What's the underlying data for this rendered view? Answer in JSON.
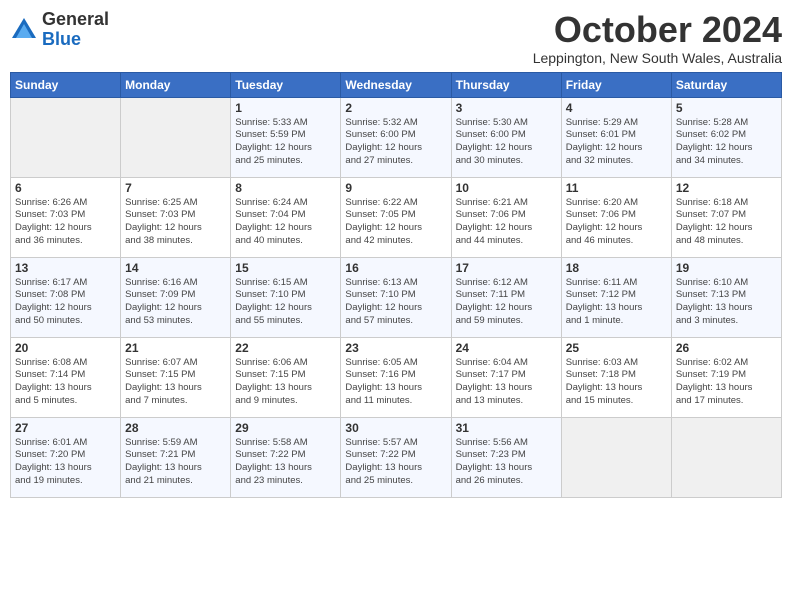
{
  "header": {
    "logo_line1": "General",
    "logo_line2": "Blue",
    "month": "October 2024",
    "location": "Leppington, New South Wales, Australia"
  },
  "weekdays": [
    "Sunday",
    "Monday",
    "Tuesday",
    "Wednesday",
    "Thursday",
    "Friday",
    "Saturday"
  ],
  "weeks": [
    [
      {
        "day": "",
        "info": ""
      },
      {
        "day": "",
        "info": ""
      },
      {
        "day": "1",
        "info": "Sunrise: 5:33 AM\nSunset: 5:59 PM\nDaylight: 12 hours\nand 25 minutes."
      },
      {
        "day": "2",
        "info": "Sunrise: 5:32 AM\nSunset: 6:00 PM\nDaylight: 12 hours\nand 27 minutes."
      },
      {
        "day": "3",
        "info": "Sunrise: 5:30 AM\nSunset: 6:00 PM\nDaylight: 12 hours\nand 30 minutes."
      },
      {
        "day": "4",
        "info": "Sunrise: 5:29 AM\nSunset: 6:01 PM\nDaylight: 12 hours\nand 32 minutes."
      },
      {
        "day": "5",
        "info": "Sunrise: 5:28 AM\nSunset: 6:02 PM\nDaylight: 12 hours\nand 34 minutes."
      }
    ],
    [
      {
        "day": "6",
        "info": "Sunrise: 6:26 AM\nSunset: 7:03 PM\nDaylight: 12 hours\nand 36 minutes."
      },
      {
        "day": "7",
        "info": "Sunrise: 6:25 AM\nSunset: 7:03 PM\nDaylight: 12 hours\nand 38 minutes."
      },
      {
        "day": "8",
        "info": "Sunrise: 6:24 AM\nSunset: 7:04 PM\nDaylight: 12 hours\nand 40 minutes."
      },
      {
        "day": "9",
        "info": "Sunrise: 6:22 AM\nSunset: 7:05 PM\nDaylight: 12 hours\nand 42 minutes."
      },
      {
        "day": "10",
        "info": "Sunrise: 6:21 AM\nSunset: 7:06 PM\nDaylight: 12 hours\nand 44 minutes."
      },
      {
        "day": "11",
        "info": "Sunrise: 6:20 AM\nSunset: 7:06 PM\nDaylight: 12 hours\nand 46 minutes."
      },
      {
        "day": "12",
        "info": "Sunrise: 6:18 AM\nSunset: 7:07 PM\nDaylight: 12 hours\nand 48 minutes."
      }
    ],
    [
      {
        "day": "13",
        "info": "Sunrise: 6:17 AM\nSunset: 7:08 PM\nDaylight: 12 hours\nand 50 minutes."
      },
      {
        "day": "14",
        "info": "Sunrise: 6:16 AM\nSunset: 7:09 PM\nDaylight: 12 hours\nand 53 minutes."
      },
      {
        "day": "15",
        "info": "Sunrise: 6:15 AM\nSunset: 7:10 PM\nDaylight: 12 hours\nand 55 minutes."
      },
      {
        "day": "16",
        "info": "Sunrise: 6:13 AM\nSunset: 7:10 PM\nDaylight: 12 hours\nand 57 minutes."
      },
      {
        "day": "17",
        "info": "Sunrise: 6:12 AM\nSunset: 7:11 PM\nDaylight: 12 hours\nand 59 minutes."
      },
      {
        "day": "18",
        "info": "Sunrise: 6:11 AM\nSunset: 7:12 PM\nDaylight: 13 hours\nand 1 minute."
      },
      {
        "day": "19",
        "info": "Sunrise: 6:10 AM\nSunset: 7:13 PM\nDaylight: 13 hours\nand 3 minutes."
      }
    ],
    [
      {
        "day": "20",
        "info": "Sunrise: 6:08 AM\nSunset: 7:14 PM\nDaylight: 13 hours\nand 5 minutes."
      },
      {
        "day": "21",
        "info": "Sunrise: 6:07 AM\nSunset: 7:15 PM\nDaylight: 13 hours\nand 7 minutes."
      },
      {
        "day": "22",
        "info": "Sunrise: 6:06 AM\nSunset: 7:15 PM\nDaylight: 13 hours\nand 9 minutes."
      },
      {
        "day": "23",
        "info": "Sunrise: 6:05 AM\nSunset: 7:16 PM\nDaylight: 13 hours\nand 11 minutes."
      },
      {
        "day": "24",
        "info": "Sunrise: 6:04 AM\nSunset: 7:17 PM\nDaylight: 13 hours\nand 13 minutes."
      },
      {
        "day": "25",
        "info": "Sunrise: 6:03 AM\nSunset: 7:18 PM\nDaylight: 13 hours\nand 15 minutes."
      },
      {
        "day": "26",
        "info": "Sunrise: 6:02 AM\nSunset: 7:19 PM\nDaylight: 13 hours\nand 17 minutes."
      }
    ],
    [
      {
        "day": "27",
        "info": "Sunrise: 6:01 AM\nSunset: 7:20 PM\nDaylight: 13 hours\nand 19 minutes."
      },
      {
        "day": "28",
        "info": "Sunrise: 5:59 AM\nSunset: 7:21 PM\nDaylight: 13 hours\nand 21 minutes."
      },
      {
        "day": "29",
        "info": "Sunrise: 5:58 AM\nSunset: 7:22 PM\nDaylight: 13 hours\nand 23 minutes."
      },
      {
        "day": "30",
        "info": "Sunrise: 5:57 AM\nSunset: 7:22 PM\nDaylight: 13 hours\nand 25 minutes."
      },
      {
        "day": "31",
        "info": "Sunrise: 5:56 AM\nSunset: 7:23 PM\nDaylight: 13 hours\nand 26 minutes."
      },
      {
        "day": "",
        "info": ""
      },
      {
        "day": "",
        "info": ""
      }
    ]
  ]
}
